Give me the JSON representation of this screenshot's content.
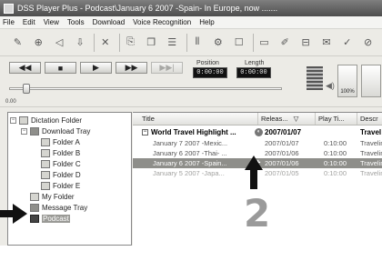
{
  "window": {
    "title": "DSS Player Plus - Podcast\\January 6 2007 -Spain-  In Europe, now ......."
  },
  "menu": [
    "File",
    "Edit",
    "View",
    "Tools",
    "Download",
    "Voice Recognition",
    "Help"
  ],
  "toolbar_icons": [
    "mic-icon",
    "record-icon",
    "speaker-icon",
    "import-icon",
    "delete-icon",
    "cut-icon",
    "copy-icon",
    "split-icon",
    "join-icon",
    "properties-icon",
    "folder-icon",
    "send-icon",
    "priority-icon",
    "lock-icon",
    "email-icon",
    "check-icon",
    "stop-circle-icon"
  ],
  "transport": {
    "rewind": "◀◀",
    "stop": "■",
    "play": "▶",
    "fast_forward": "▶▶",
    "skip": "▶▶|",
    "position_label": "Position",
    "position_value": "0:00:00",
    "length_label": "Length",
    "length_value": "0:00:00",
    "playback_progress": 0.05,
    "zoom_label": "100%",
    "status_value": "0.00"
  },
  "tree": {
    "items": [
      {
        "label": "Dictation Folder",
        "expander": "−"
      },
      {
        "label": "Download Tray",
        "expander": "−"
      },
      {
        "label": "Folder A"
      },
      {
        "label": "Folder B"
      },
      {
        "label": "Folder C"
      },
      {
        "label": "Folder D"
      },
      {
        "label": "Folder E"
      },
      {
        "label": "My Folder"
      },
      {
        "label": "Message Tray"
      },
      {
        "label": "Podcast"
      }
    ]
  },
  "list": {
    "columns": [
      "Title",
      "Releas...",
      "Play Ti...",
      "Descr"
    ],
    "group": {
      "title": "World Travel Highlight ...",
      "date": "2007/01/07",
      "description": "Travel",
      "expander": "−"
    },
    "rows": [
      {
        "title": "January 7 2007 -Mexic...",
        "release": "2007/01/07",
        "play_time": "0:10:00",
        "desc": "Travelin"
      },
      {
        "title": "January 6 2007 -Thai- ...",
        "release": "2007/01/06",
        "play_time": "0:10:00",
        "desc": "Travelin"
      },
      {
        "title": "January 6 2007 -Spain...",
        "release": "2007/01/06",
        "play_time": "0:10:00",
        "desc": "Travelin"
      },
      {
        "title": "January 5 2007 -Japa...",
        "release": "2007/01/05",
        "play_time": "0:10:00",
        "desc": "Travelin"
      }
    ]
  },
  "callout": {
    "step_number": "2"
  },
  "colors": {
    "arrow": "#111111",
    "selection": "#8e8e8a",
    "titlebar": "#5a5a5a"
  }
}
